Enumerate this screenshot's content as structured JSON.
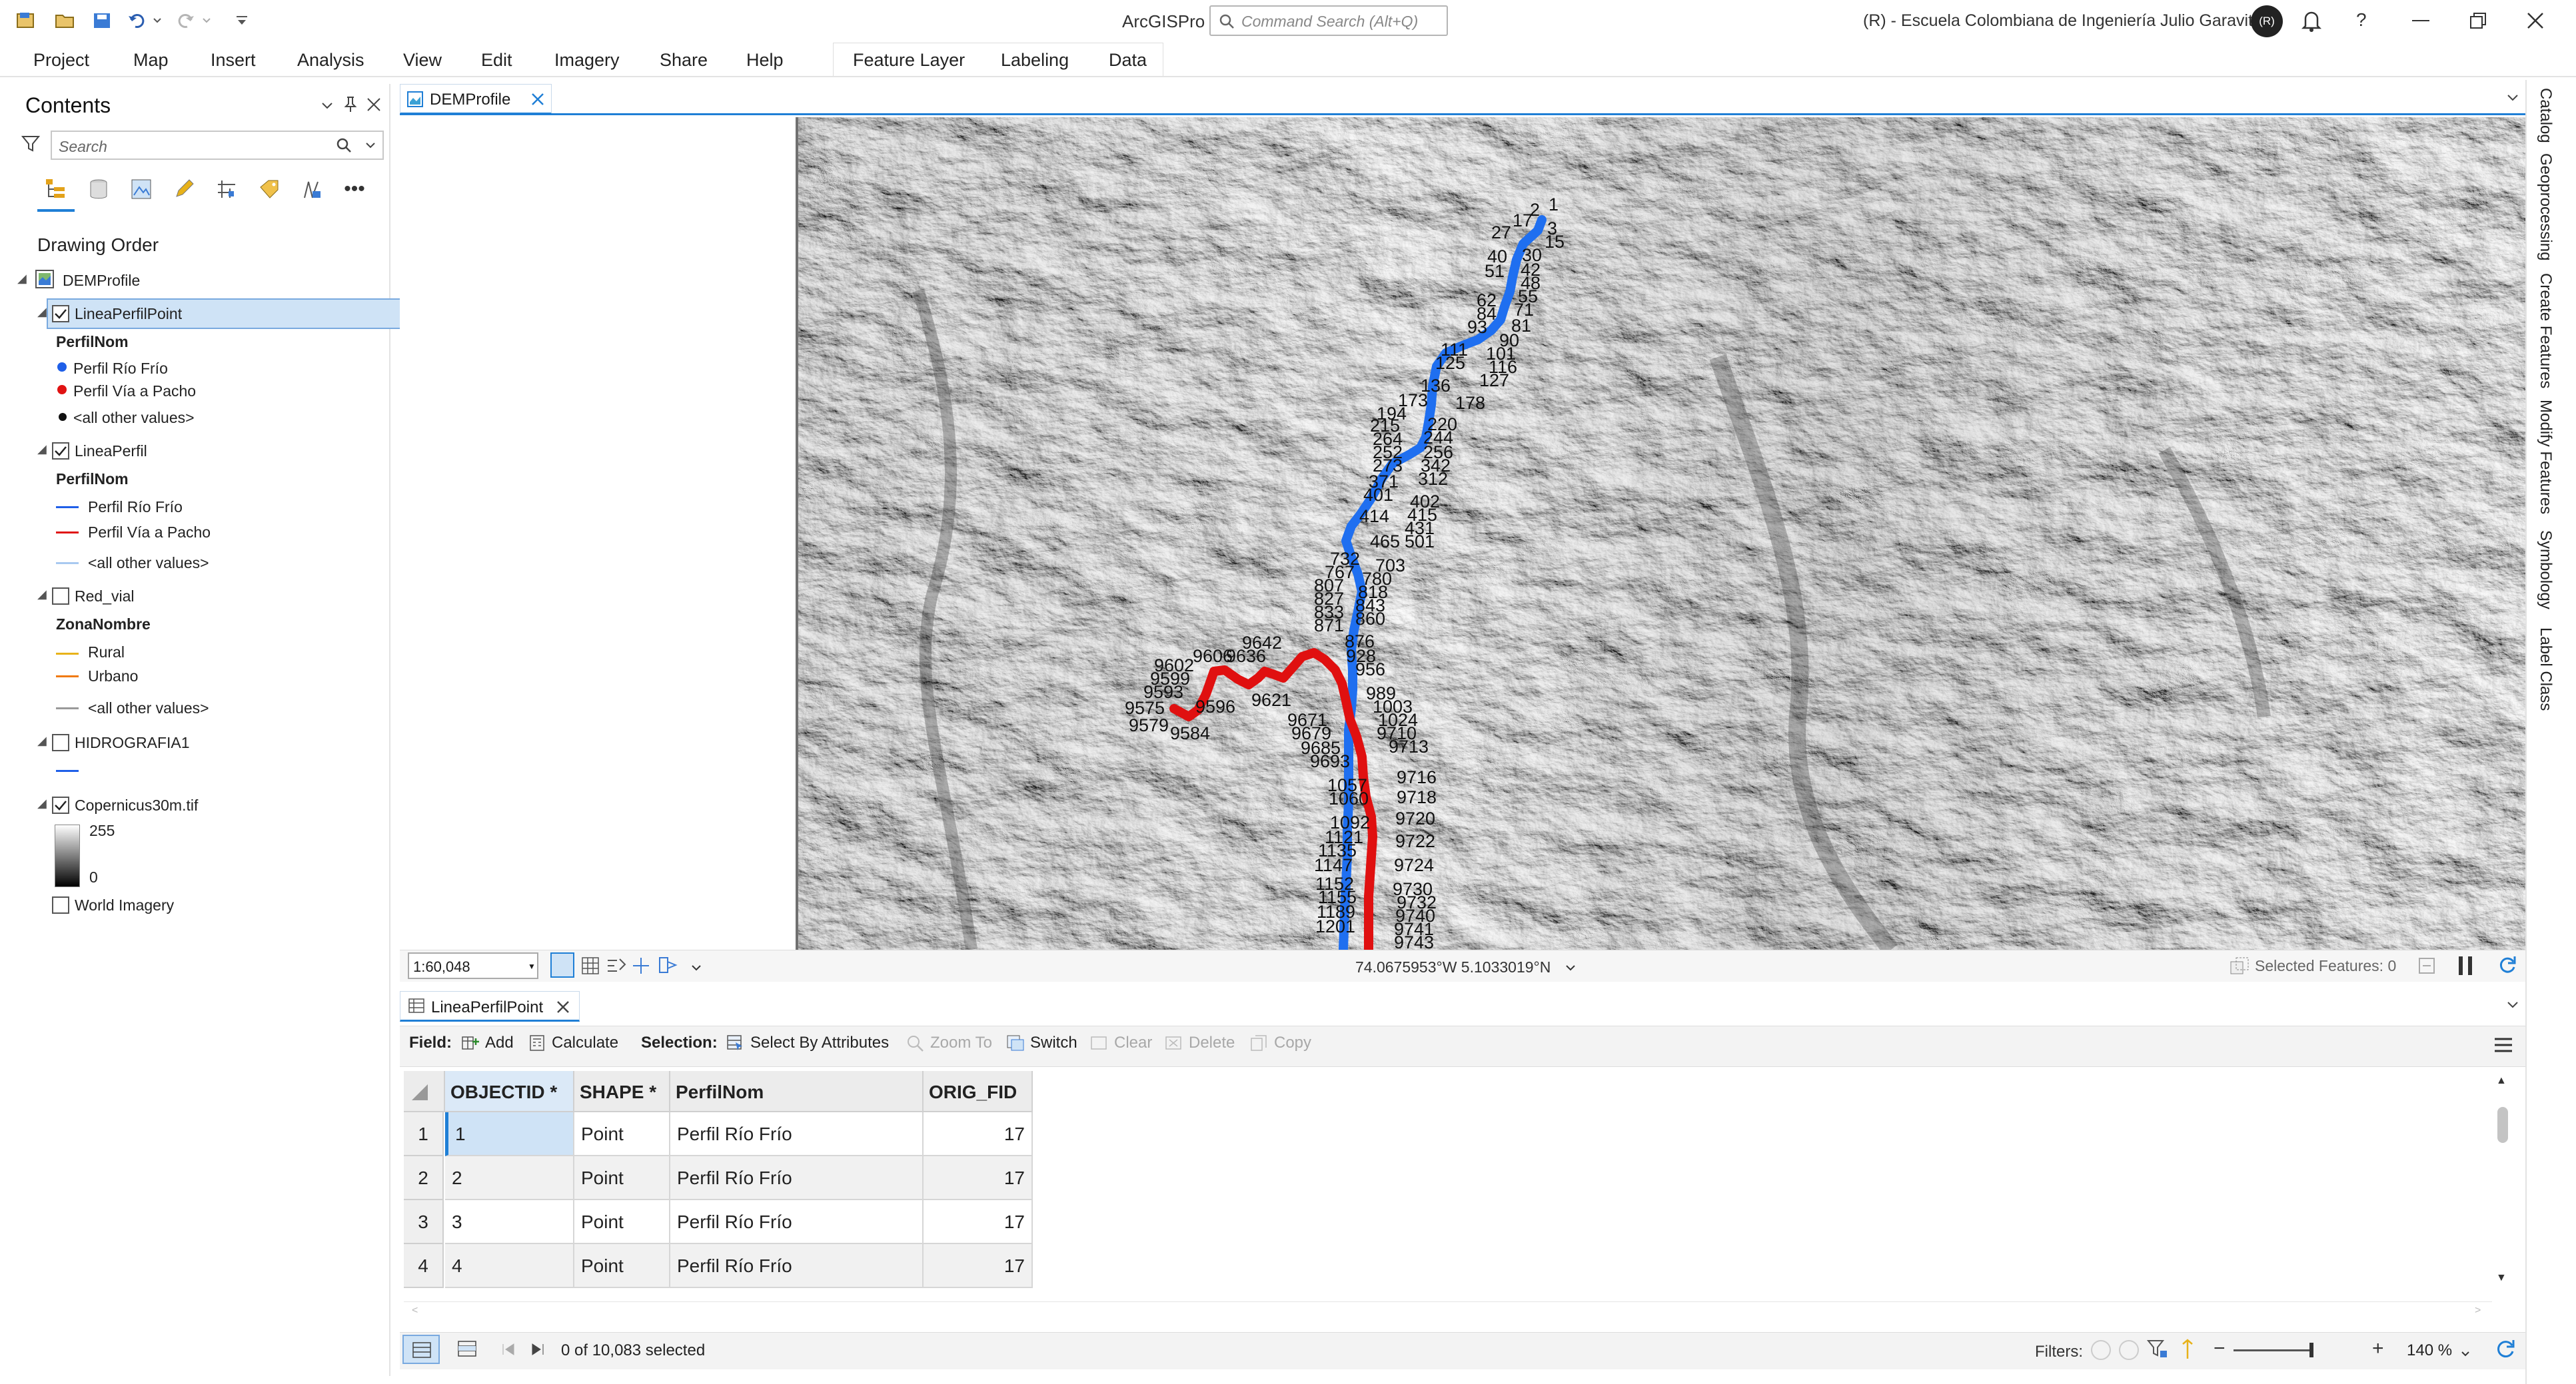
{
  "app": {
    "title": "ArcGISPro",
    "command_search_placeholder": "Command Search (Alt+Q)",
    "org_name": "(R) - Escuela Colombiana de Ingeniería Julio Garavito",
    "avatar_initials": "(R)"
  },
  "menu": {
    "items": [
      "Project",
      "Map",
      "Insert",
      "Analysis",
      "View",
      "Edit",
      "Imagery",
      "Share",
      "Help"
    ],
    "context_tabs": [
      "Feature Layer",
      "Labeling",
      "Data"
    ]
  },
  "contents": {
    "title": "Contents",
    "search_placeholder": "Search",
    "drawing_order_label": "Drawing Order",
    "map_name": "DEMProfile",
    "layers": [
      {
        "name": "LineaPerfilPoint",
        "checked": true,
        "selected": true,
        "field": "PerfilNom",
        "legend": [
          {
            "label": "Perfil Río Frío",
            "color": "#1f5fe8",
            "symbol": "point"
          },
          {
            "label": "Perfil Vía a Pacho",
            "color": "#e01212",
            "symbol": "point"
          },
          {
            "label": "<all other values>",
            "color": "#111111",
            "symbol": "point"
          }
        ]
      },
      {
        "name": "LineaPerfil",
        "checked": true,
        "field": "PerfilNom",
        "legend": [
          {
            "label": "Perfil Río Frío",
            "color": "#1f5fe8",
            "symbol": "line"
          },
          {
            "label": "Perfil Vía a Pacho",
            "color": "#e01212",
            "symbol": "line"
          },
          {
            "label": "<all other values>",
            "color": "#a8c9f0",
            "symbol": "line"
          }
        ]
      },
      {
        "name": "Red_vial",
        "checked": false,
        "field": "ZonaNombre",
        "legend": [
          {
            "label": "Rural",
            "color": "#e8b21a",
            "symbol": "line"
          },
          {
            "label": "Urbano",
            "color": "#f07a10",
            "symbol": "line"
          },
          {
            "label": "<all other values>",
            "color": "#9a9a9a",
            "symbol": "line"
          }
        ]
      },
      {
        "name": "HIDROGRAFIA1",
        "checked": false,
        "field": "",
        "legend": [
          {
            "label": "",
            "color": "#1f5fe8",
            "symbol": "line"
          }
        ]
      },
      {
        "name": "Copernicus30m.tif",
        "checked": true,
        "field": "",
        "ramp": {
          "high": "255",
          "low": "0"
        }
      },
      {
        "name": "World Imagery",
        "checked": false
      }
    ]
  },
  "map": {
    "tab_label": "DEMProfile",
    "scale": "1:60,048",
    "coordinates": "74.0675953°W 5.1033019°N",
    "selected_features": "Selected Features: 0",
    "blue_labels": [
      "1",
      "2",
      "17",
      "27",
      "3",
      "15",
      "40",
      "30",
      "51",
      "42",
      "48",
      "55",
      "62",
      "84",
      "71",
      "93",
      "81",
      "90",
      "111",
      "101",
      "125",
      "116",
      "127",
      "136",
      "173",
      "178",
      "194",
      "220",
      "215",
      "244",
      "264",
      "252",
      "256",
      "273",
      "342",
      "312",
      "371",
      "402",
      "401",
      "415",
      "414",
      "431",
      "465",
      "501",
      "732",
      "767",
      "703",
      "807",
      "780",
      "827",
      "818",
      "833",
      "843",
      "871",
      "860",
      "876",
      "928",
      "956",
      "989",
      "1003",
      "1024",
      "1057",
      "1060",
      "1092",
      "1121",
      "1135",
      "1147",
      "1152",
      "1155",
      "1189",
      "1201"
    ],
    "red_labels": [
      "9642",
      "9602",
      "9606",
      "9636",
      "9599",
      "9593",
      "9596",
      "9621",
      "9575",
      "9579",
      "9584",
      "9671",
      "9679",
      "9685",
      "9693",
      "9710",
      "9713",
      "9716",
      "9718",
      "9720",
      "9722",
      "9724",
      "9730",
      "9732",
      "9740",
      "9741",
      "9743"
    ]
  },
  "right_dock": [
    "Catalog",
    "Geoprocessing",
    "Create Features",
    "Modify Features",
    "Symbology",
    "Label Class"
  ],
  "table": {
    "tab_label": "LineaPerfilPoint",
    "toolbar": {
      "field_label": "Field:",
      "add": "Add",
      "calculate": "Calculate",
      "selection_label": "Selection:",
      "select_by_attributes": "Select By Attributes",
      "zoom_to": "Zoom To",
      "switch": "Switch",
      "clear": "Clear",
      "delete": "Delete",
      "copy": "Copy"
    },
    "columns": [
      "OBJECTID *",
      "SHAPE *",
      "PerfilNom",
      "ORIG_FID"
    ],
    "rows": [
      {
        "n": "1",
        "objectid": "1",
        "shape": "Point",
        "perfil": "Perfil Río Frío",
        "orig_fid": "17"
      },
      {
        "n": "2",
        "objectid": "2",
        "shape": "Point",
        "perfil": "Perfil Río Frío",
        "orig_fid": "17"
      },
      {
        "n": "3",
        "objectid": "3",
        "shape": "Point",
        "perfil": "Perfil Río Frío",
        "orig_fid": "17"
      },
      {
        "n": "4",
        "objectid": "4",
        "shape": "Point",
        "perfil": "Perfil Río Frío",
        "orig_fid": "17"
      }
    ],
    "selection_count": "0 of 10,083 selected",
    "filters_label": "Filters:",
    "zoom_level": "140 %"
  },
  "colors": {
    "accent": "#1f7fd6",
    "route_blue": "#1f6ff0",
    "route_red": "#e01010",
    "selection_row": "#cfe3f6"
  }
}
